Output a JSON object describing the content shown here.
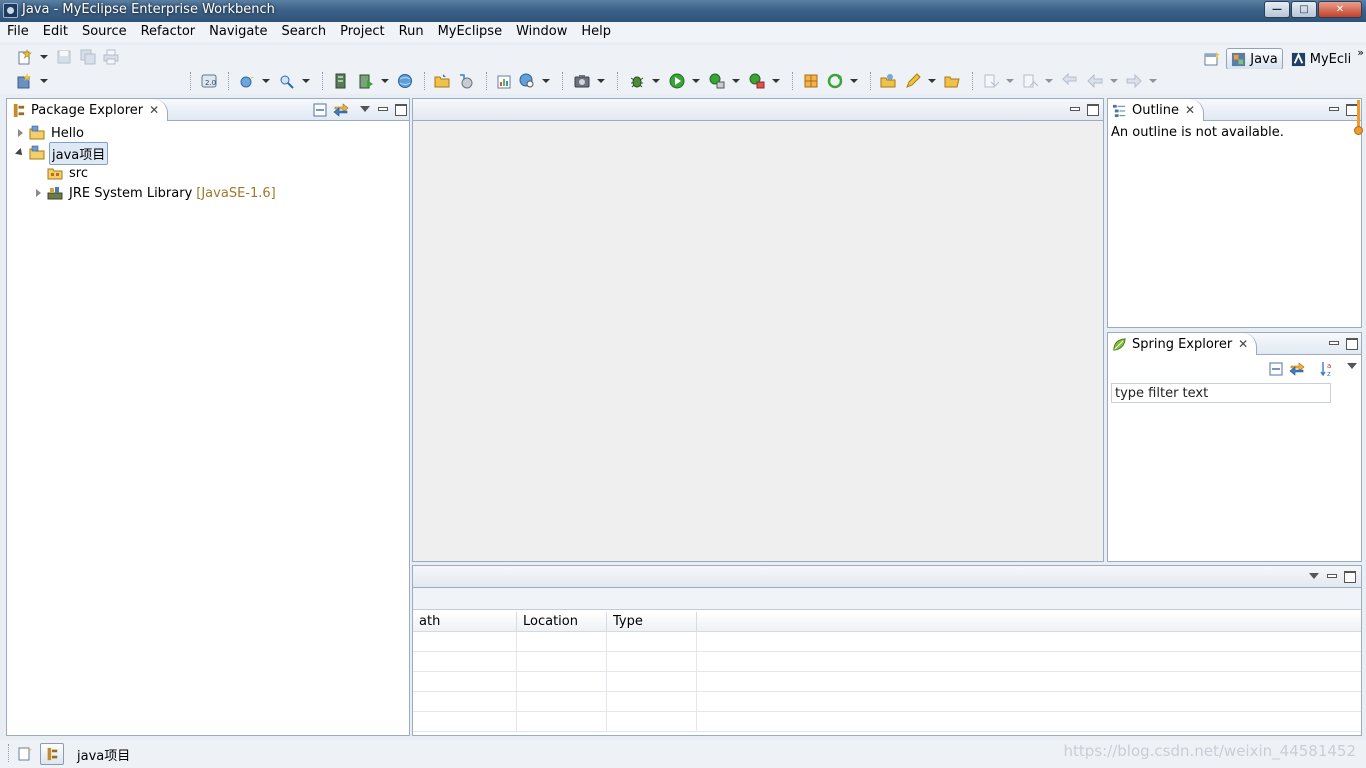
{
  "window": {
    "title": "Java - MyEclipse Enterprise Workbench",
    "buttons": [
      "minimize",
      "maximize",
      "close"
    ]
  },
  "menu": [
    "File",
    "Edit",
    "Source",
    "Refactor",
    "Navigate",
    "Search",
    "Project",
    "Run",
    "MyEclipse",
    "Window",
    "Help"
  ],
  "perspectives": [
    {
      "label": "Java",
      "active": true,
      "icon": "java-perspective-icon"
    },
    {
      "label": "MyEcli",
      "active": false,
      "icon": "myeclipse-perspective-icon"
    }
  ],
  "package_explorer": {
    "title": "Package Explorer",
    "tree": [
      {
        "label": "Hello",
        "level": 0,
        "expanded": false,
        "icon": "project-folder-icon"
      },
      {
        "label": "java项目",
        "level": 0,
        "expanded": true,
        "selected": true,
        "icon": "project-folder-icon"
      },
      {
        "label": "src",
        "level": 1,
        "icon": "source-folder-icon"
      },
      {
        "label": "JRE System Library",
        "decoration": "[JavaSE-1.6]",
        "level": 1,
        "expanded": false,
        "icon": "library-icon"
      }
    ]
  },
  "outline": {
    "title": "Outline",
    "message": "An outline is not available."
  },
  "spring_explorer": {
    "title": "Spring Explorer",
    "filter_value": "type filter text"
  },
  "bottom_panel": {
    "columns": [
      "ath",
      "Location",
      "Type"
    ],
    "empty_rows": 5
  },
  "status_bar": {
    "selection_label": "java项目",
    "watermark": "https://blog.csdn.net/weixin_44581452"
  },
  "colors": {
    "accent_orange": "#f19a2c",
    "selection_border": "#7da2ce",
    "view_border": "#9aabc2"
  }
}
